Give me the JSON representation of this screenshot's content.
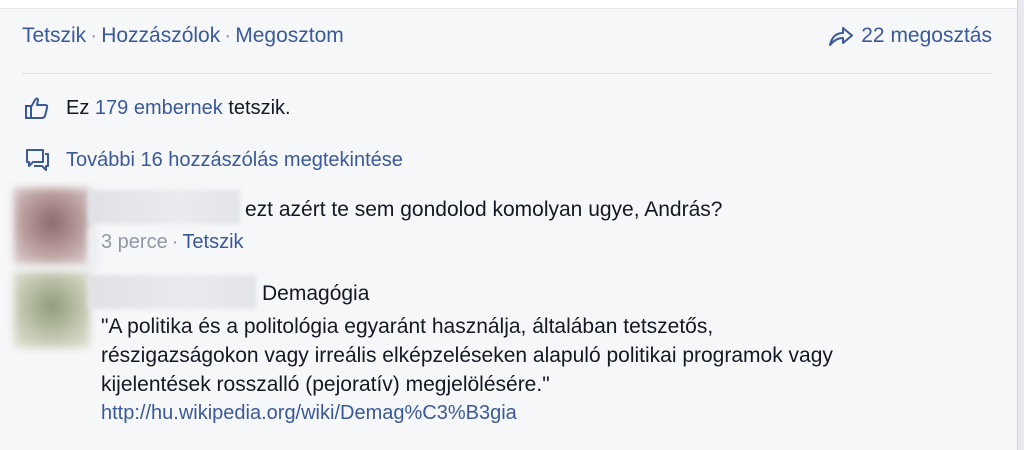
{
  "actions": {
    "like": "Tetszik",
    "comment": "Hozzászólok",
    "share_action": "Megosztom",
    "separator": "·",
    "shares_count": "22 megosztás"
  },
  "likes": {
    "prefix": "Ez",
    "count_link": "179 embernek",
    "suffix": "tetszik."
  },
  "more_comments": "További 16 hozzászólás megtekintése",
  "comments": [
    {
      "text": "ezt azért te sem gondolod komolyan ugye, András?",
      "time": "3 perce",
      "like": "Tetszik"
    },
    {
      "text_title": "Demagógia",
      "body_line1": "\"A politika és a politológia egyaránt használja, általában tetszetős,",
      "body_line2": "részigazságokon vagy irreális elképzeléseken alapuló politikai programok vagy",
      "body_line3": "kijelentések rosszalló (pejoratív) megjelölésére.\"",
      "url": "http://hu.wikipedia.org/wiki/Demag%C3%B3gia"
    }
  ],
  "colors": {
    "link": "#3b5998",
    "meta": "#9197a3",
    "text": "#141823",
    "background": "#f6f7f9"
  },
  "icons": {
    "share": "share-arrow-icon",
    "like": "thumbs-up-icon",
    "comments": "comment-bubbles-icon"
  }
}
